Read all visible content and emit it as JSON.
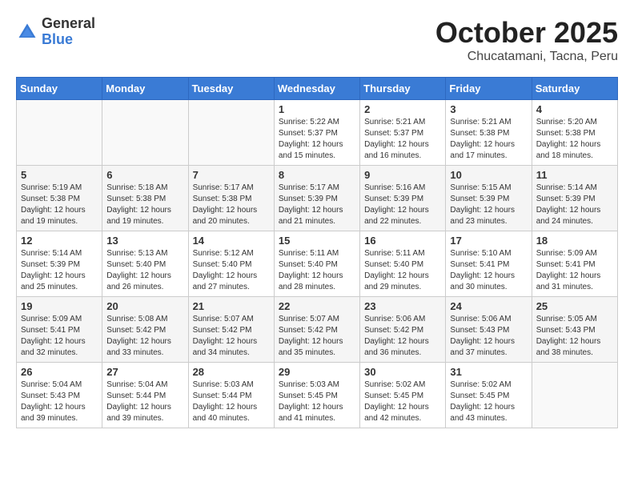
{
  "header": {
    "logo_general": "General",
    "logo_blue": "Blue",
    "month": "October 2025",
    "location": "Chucatamani, Tacna, Peru"
  },
  "weekdays": [
    "Sunday",
    "Monday",
    "Tuesday",
    "Wednesday",
    "Thursday",
    "Friday",
    "Saturday"
  ],
  "weeks": [
    [
      {
        "day": "",
        "info": ""
      },
      {
        "day": "",
        "info": ""
      },
      {
        "day": "",
        "info": ""
      },
      {
        "day": "1",
        "info": "Sunrise: 5:22 AM\nSunset: 5:37 PM\nDaylight: 12 hours\nand 15 minutes."
      },
      {
        "day": "2",
        "info": "Sunrise: 5:21 AM\nSunset: 5:37 PM\nDaylight: 12 hours\nand 16 minutes."
      },
      {
        "day": "3",
        "info": "Sunrise: 5:21 AM\nSunset: 5:38 PM\nDaylight: 12 hours\nand 17 minutes."
      },
      {
        "day": "4",
        "info": "Sunrise: 5:20 AM\nSunset: 5:38 PM\nDaylight: 12 hours\nand 18 minutes."
      }
    ],
    [
      {
        "day": "5",
        "info": "Sunrise: 5:19 AM\nSunset: 5:38 PM\nDaylight: 12 hours\nand 19 minutes."
      },
      {
        "day": "6",
        "info": "Sunrise: 5:18 AM\nSunset: 5:38 PM\nDaylight: 12 hours\nand 19 minutes."
      },
      {
        "day": "7",
        "info": "Sunrise: 5:17 AM\nSunset: 5:38 PM\nDaylight: 12 hours\nand 20 minutes."
      },
      {
        "day": "8",
        "info": "Sunrise: 5:17 AM\nSunset: 5:39 PM\nDaylight: 12 hours\nand 21 minutes."
      },
      {
        "day": "9",
        "info": "Sunrise: 5:16 AM\nSunset: 5:39 PM\nDaylight: 12 hours\nand 22 minutes."
      },
      {
        "day": "10",
        "info": "Sunrise: 5:15 AM\nSunset: 5:39 PM\nDaylight: 12 hours\nand 23 minutes."
      },
      {
        "day": "11",
        "info": "Sunrise: 5:14 AM\nSunset: 5:39 PM\nDaylight: 12 hours\nand 24 minutes."
      }
    ],
    [
      {
        "day": "12",
        "info": "Sunrise: 5:14 AM\nSunset: 5:39 PM\nDaylight: 12 hours\nand 25 minutes."
      },
      {
        "day": "13",
        "info": "Sunrise: 5:13 AM\nSunset: 5:40 PM\nDaylight: 12 hours\nand 26 minutes."
      },
      {
        "day": "14",
        "info": "Sunrise: 5:12 AM\nSunset: 5:40 PM\nDaylight: 12 hours\nand 27 minutes."
      },
      {
        "day": "15",
        "info": "Sunrise: 5:11 AM\nSunset: 5:40 PM\nDaylight: 12 hours\nand 28 minutes."
      },
      {
        "day": "16",
        "info": "Sunrise: 5:11 AM\nSunset: 5:40 PM\nDaylight: 12 hours\nand 29 minutes."
      },
      {
        "day": "17",
        "info": "Sunrise: 5:10 AM\nSunset: 5:41 PM\nDaylight: 12 hours\nand 30 minutes."
      },
      {
        "day": "18",
        "info": "Sunrise: 5:09 AM\nSunset: 5:41 PM\nDaylight: 12 hours\nand 31 minutes."
      }
    ],
    [
      {
        "day": "19",
        "info": "Sunrise: 5:09 AM\nSunset: 5:41 PM\nDaylight: 12 hours\nand 32 minutes."
      },
      {
        "day": "20",
        "info": "Sunrise: 5:08 AM\nSunset: 5:42 PM\nDaylight: 12 hours\nand 33 minutes."
      },
      {
        "day": "21",
        "info": "Sunrise: 5:07 AM\nSunset: 5:42 PM\nDaylight: 12 hours\nand 34 minutes."
      },
      {
        "day": "22",
        "info": "Sunrise: 5:07 AM\nSunset: 5:42 PM\nDaylight: 12 hours\nand 35 minutes."
      },
      {
        "day": "23",
        "info": "Sunrise: 5:06 AM\nSunset: 5:42 PM\nDaylight: 12 hours\nand 36 minutes."
      },
      {
        "day": "24",
        "info": "Sunrise: 5:06 AM\nSunset: 5:43 PM\nDaylight: 12 hours\nand 37 minutes."
      },
      {
        "day": "25",
        "info": "Sunrise: 5:05 AM\nSunset: 5:43 PM\nDaylight: 12 hours\nand 38 minutes."
      }
    ],
    [
      {
        "day": "26",
        "info": "Sunrise: 5:04 AM\nSunset: 5:43 PM\nDaylight: 12 hours\nand 39 minutes."
      },
      {
        "day": "27",
        "info": "Sunrise: 5:04 AM\nSunset: 5:44 PM\nDaylight: 12 hours\nand 39 minutes."
      },
      {
        "day": "28",
        "info": "Sunrise: 5:03 AM\nSunset: 5:44 PM\nDaylight: 12 hours\nand 40 minutes."
      },
      {
        "day": "29",
        "info": "Sunrise: 5:03 AM\nSunset: 5:45 PM\nDaylight: 12 hours\nand 41 minutes."
      },
      {
        "day": "30",
        "info": "Sunrise: 5:02 AM\nSunset: 5:45 PM\nDaylight: 12 hours\nand 42 minutes."
      },
      {
        "day": "31",
        "info": "Sunrise: 5:02 AM\nSunset: 5:45 PM\nDaylight: 12 hours\nand 43 minutes."
      },
      {
        "day": "",
        "info": ""
      }
    ]
  ]
}
